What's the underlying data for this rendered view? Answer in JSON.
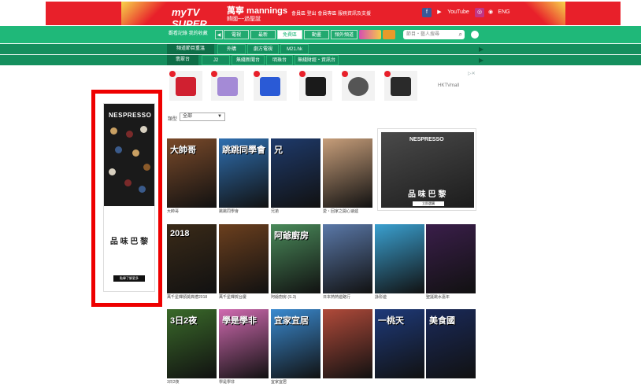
{
  "topbar": {
    "logo": "myTV SUPER",
    "brand": "萬寧 mannings",
    "brand_sub": "韓國~~過聖誕",
    "links": "會員區 登出 會員專區 服務資訊及支援",
    "youtube": "YouTube",
    "lang": "ENG"
  },
  "nav1": {
    "left_text": "觀看記錄 我的收藏",
    "tabs": [
      "電視",
      "最新",
      "免費區",
      "動畫",
      "頻外頻道"
    ],
    "active_tab": "免費區",
    "search_placeholder": "節目・藝人搜尋"
  },
  "nav2": {
    "title": "頻道節目重溫",
    "tabs": [
      "外購",
      "劇方電視",
      "M21.hk"
    ]
  },
  "nav3": {
    "title": "翡翠台",
    "tabs": [
      "J2",
      "無綫新聞台",
      "明珠台",
      "無綫財經・資訊台"
    ]
  },
  "product_strip": {
    "ad_label": "HKTVmall"
  },
  "filter": {
    "label": "類型",
    "selected": "全部"
  },
  "left_ad": {
    "brand": "NESPRESSO",
    "tagline": "品 味 巴 黎",
    "cta": "點擊了解更多"
  },
  "right_ad": {
    "brand": "NESPRESSO",
    "tagline": "品 味 巴 黎",
    "cta": "立即選購"
  },
  "shows": [
    {
      "caption": "大帥哥",
      "title": "大帥哥",
      "color": "#7a4a2a"
    },
    {
      "caption": "跳跳同學會",
      "title": "跳跳同學會",
      "color": "#2f6fb0"
    },
    {
      "caption": "兄弟",
      "title": "兄",
      "color": "#1e3a6b"
    },
    {
      "caption": "愛・回家之開心速遞",
      "title": "",
      "color": "#c79e7a"
    },
    {
      "caption": "萬千星輝頒獎典禮2018",
      "title": "2018",
      "color": "#3a2a18"
    },
    {
      "caption": "萬千星輝賀台慶",
      "title": "",
      "color": "#6b3f1e"
    },
    {
      "caption": "阿爺廚房 (S.3)",
      "title": "阿爺廚房",
      "color": "#4a8a5a"
    },
    {
      "caption": "日本熱熱遊路行",
      "title": "",
      "color": "#5a78a8"
    },
    {
      "caption": "詠彤遊",
      "title": "",
      "color": "#3aa0d0"
    },
    {
      "caption": "聖誕跳水嘉年",
      "title": "",
      "color": "#3a1e4a"
    },
    {
      "caption": "3日2夜",
      "title": "3日2夜",
      "color": "#3a6a2a"
    },
    {
      "caption": "學是學非",
      "title": "學是學非",
      "color": "#d06ab0"
    },
    {
      "caption": "宜家宜居",
      "title": "宜家宜居",
      "color": "#3a8ad0"
    },
    {
      "caption": "",
      "title": "",
      "color": "#b04a3a"
    },
    {
      "caption": "",
      "title": "一桃天",
      "color": "#1e3a7a"
    },
    {
      "caption": "",
      "title": "美食國",
      "color": "#1a2a5a"
    }
  ]
}
